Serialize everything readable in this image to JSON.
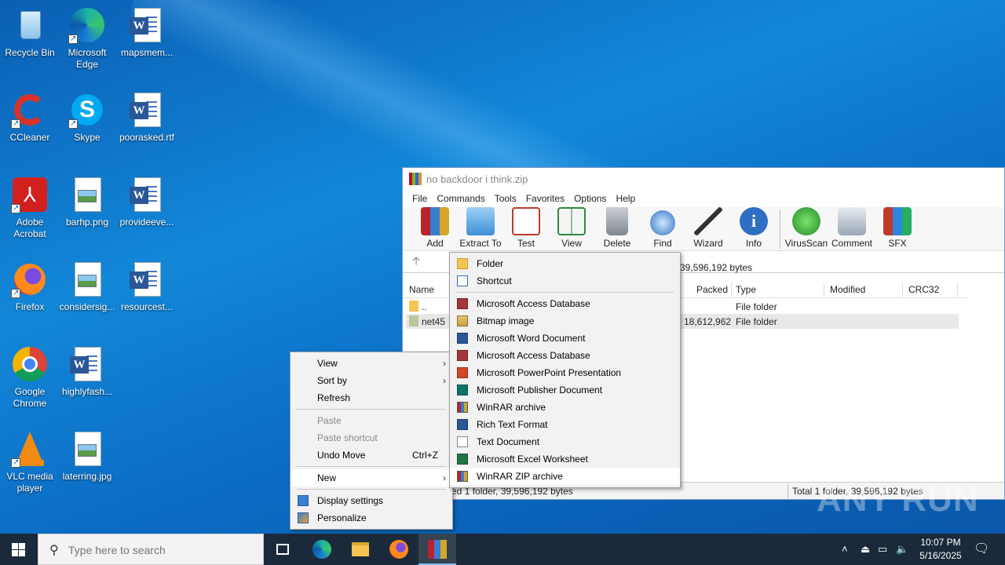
{
  "desktop": {
    "icons": [
      {
        "label": "Recycle Bin"
      },
      {
        "label": "Microsoft Edge"
      },
      {
        "label": "mapsmem..."
      },
      {
        "label": "CCleaner"
      },
      {
        "label": "Skype"
      },
      {
        "label": "poorasked.rtf"
      },
      {
        "label": "Adobe Acrobat"
      },
      {
        "label": "barhp.png"
      },
      {
        "label": "provideeve..."
      },
      {
        "label": "Firefox"
      },
      {
        "label": "considersig..."
      },
      {
        "label": "resourcest..."
      },
      {
        "label": "Google Chrome"
      },
      {
        "label": "highlyfash..."
      },
      {
        "label": "VLC media player"
      },
      {
        "label": "laterring.jpg"
      }
    ]
  },
  "winrar": {
    "title": "no backdoor i think.zip",
    "menu": [
      "File",
      "Commands",
      "Tools",
      "Favorites",
      "Options",
      "Help"
    ],
    "toolbar": [
      "Add",
      "Extract To",
      "Test",
      "View",
      "Delete",
      "Find",
      "Wizard",
      "Info",
      "VirusScan",
      "Comment",
      "SFX"
    ],
    "address_tail": "39,596,192 bytes",
    "columns": {
      "name": "Name",
      "packed": "Packed",
      "type": "Type",
      "modified": "Modified",
      "crc": "CRC32"
    },
    "rows": [
      {
        "name": "..",
        "packed": "",
        "type": "File folder"
      },
      {
        "name": "net45",
        "packed": "18,612,962",
        "type": "File folder"
      }
    ],
    "status_left": "ected 1 folder, 39,596,192 bytes",
    "status_right": "Total 1 folder, 39,596,192 bytes"
  },
  "context_menu": {
    "view": "View",
    "sort_by": "Sort by",
    "refresh": "Refresh",
    "paste": "Paste",
    "paste_shortcut": "Paste shortcut",
    "undo_move": "Undo Move",
    "undo_shortcut": "Ctrl+Z",
    "new": "New",
    "display_settings": "Display settings",
    "personalize": "Personalize"
  },
  "new_submenu": [
    {
      "label": "Folder",
      "icon": "folder-icon"
    },
    {
      "label": "Shortcut",
      "icon": "shortcut-icon"
    },
    {
      "label": "Microsoft Access Database",
      "icon": "access-icon"
    },
    {
      "label": "Bitmap image",
      "icon": "bitmap-icon"
    },
    {
      "label": "Microsoft Word Document",
      "icon": "word-icon"
    },
    {
      "label": "Microsoft Access Database",
      "icon": "access-icon"
    },
    {
      "label": "Microsoft PowerPoint Presentation",
      "icon": "powerpoint-icon"
    },
    {
      "label": "Microsoft Publisher Document",
      "icon": "publisher-icon"
    },
    {
      "label": "WinRAR archive",
      "icon": "winrar-icon"
    },
    {
      "label": "Rich Text Format",
      "icon": "rtf-icon"
    },
    {
      "label": "Text Document",
      "icon": "text-icon"
    },
    {
      "label": "Microsoft Excel Worksheet",
      "icon": "excel-icon"
    },
    {
      "label": "WinRAR ZIP archive",
      "icon": "winrar-zip-icon"
    }
  ],
  "taskbar": {
    "search_placeholder": "Type here to search",
    "time": "10:07 PM",
    "date": "5/16/2025"
  },
  "watermark": "ANY RUN"
}
